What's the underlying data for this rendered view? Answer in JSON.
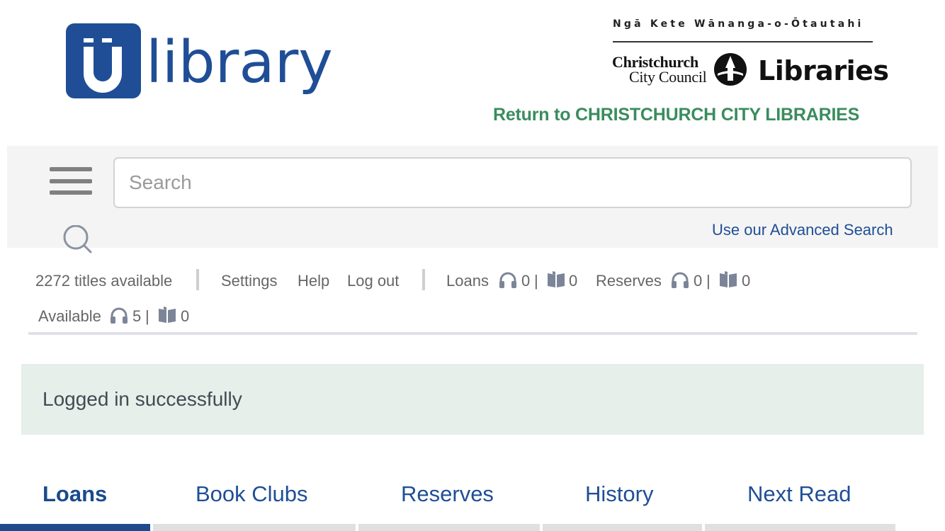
{
  "header": {
    "logo_text": "library",
    "partner_logo": {
      "maori_name": "Ngā Kete Wānanga-o-Ōtautahi",
      "council_line1": "Christchurch",
      "council_line2": "City Council",
      "libraries": "Libraries"
    },
    "return_link": "Return to CHRISTCHURCH CITY LIBRARIES"
  },
  "search": {
    "placeholder": "Search",
    "value": "",
    "advanced_link": "Use our Advanced Search"
  },
  "status": {
    "titles_available": "2272 titles available",
    "links": {
      "settings": "Settings",
      "help": "Help",
      "logout": "Log out"
    },
    "loans": {
      "label": "Loans",
      "audio": "0",
      "ebook": "0"
    },
    "reserves": {
      "label": "Reserves",
      "audio": "0",
      "ebook": "0"
    },
    "available": {
      "label": "Available",
      "audio": "5",
      "ebook": "0"
    },
    "separator": "|"
  },
  "alert": {
    "message": "Logged in successfully"
  },
  "tabs": [
    {
      "label": "Loans",
      "active": true
    },
    {
      "label": "Book Clubs",
      "active": false
    },
    {
      "label": "Reserves",
      "active": false
    },
    {
      "label": "History",
      "active": false
    },
    {
      "label": "Next Read",
      "active": false
    }
  ],
  "colors": {
    "brand_blue": "#1f4e96",
    "return_green": "#3a8c5e",
    "alert_bg": "#e6efea",
    "band_bg": "#f4f4f4",
    "active_tab_bar": "#1e4a8c"
  },
  "icons": [
    "menu-icon",
    "search-icon",
    "headphones-icon",
    "book-icon",
    "council-seal-icon"
  ]
}
